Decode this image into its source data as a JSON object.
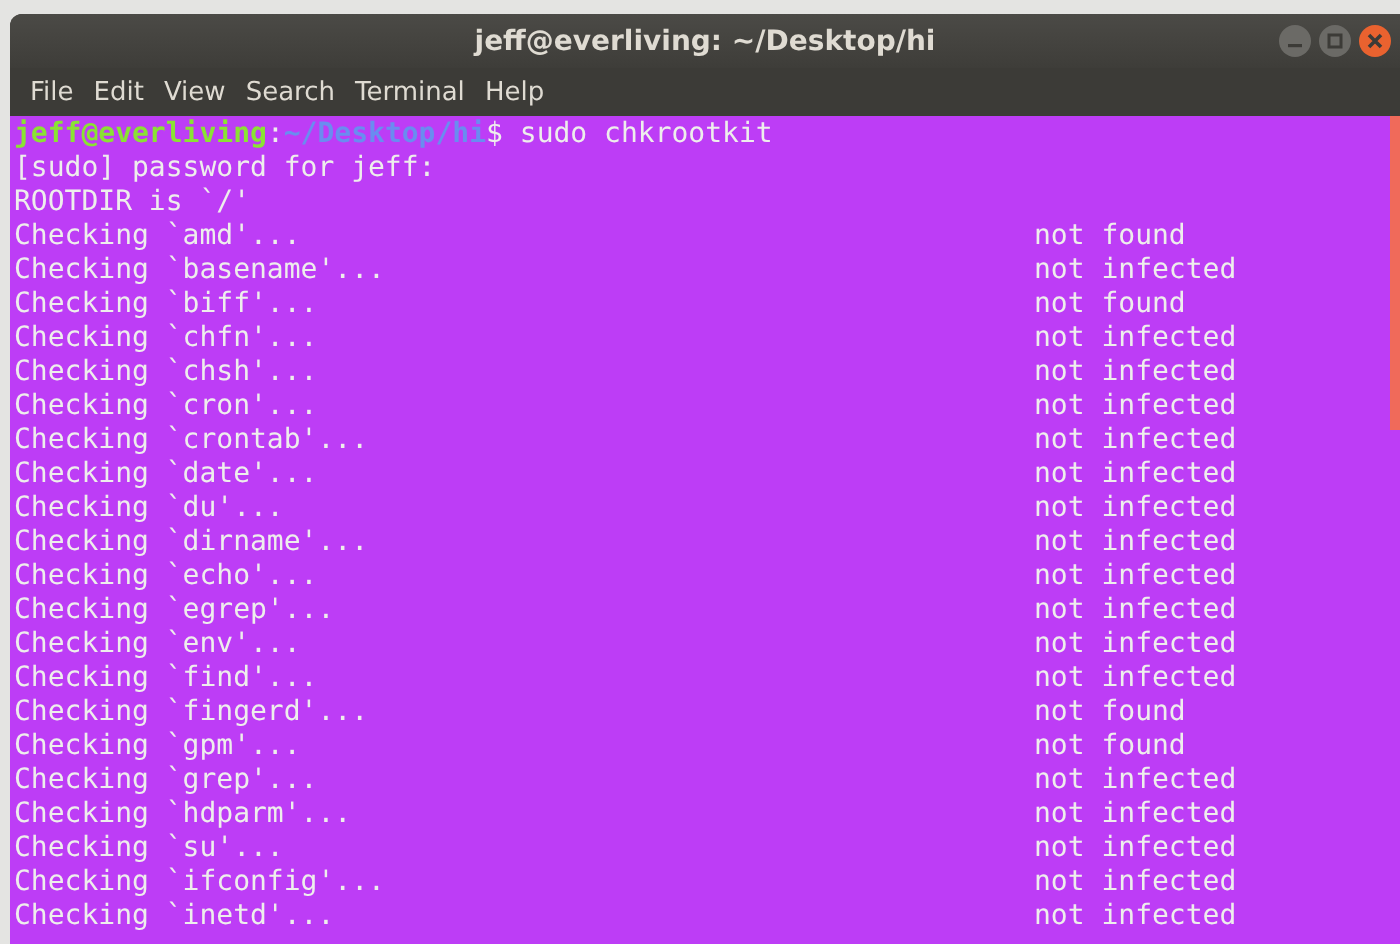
{
  "window": {
    "title": "jeff@everliving: ~/Desktop/hi"
  },
  "menu": [
    "File",
    "Edit",
    "View",
    "Search",
    "Terminal",
    "Help"
  ],
  "terminal": {
    "prompt": {
      "user": "jeff@everliving",
      "separator": ":",
      "path": "~/Desktop/hi",
      "command": "$ sudo chkrootkit"
    },
    "output": [
      "[sudo] password for jeff:",
      "ROOTDIR is `/'"
    ],
    "checks": [
      {
        "name": "Checking `amd'...",
        "result": "not found"
      },
      {
        "name": "Checking `basename'...",
        "result": "not infected"
      },
      {
        "name": "Checking `biff'...",
        "result": "not found"
      },
      {
        "name": "Checking `chfn'...",
        "result": "not infected"
      },
      {
        "name": "Checking `chsh'...",
        "result": "not infected"
      },
      {
        "name": "Checking `cron'...",
        "result": "not infected"
      },
      {
        "name": "Checking `crontab'...",
        "result": "not infected"
      },
      {
        "name": "Checking `date'...",
        "result": "not infected"
      },
      {
        "name": "Checking `du'...",
        "result": "not infected"
      },
      {
        "name": "Checking `dirname'...",
        "result": "not infected"
      },
      {
        "name": "Checking `echo'...",
        "result": "not infected"
      },
      {
        "name": "Checking `egrep'...",
        "result": "not infected"
      },
      {
        "name": "Checking `env'...",
        "result": "not infected"
      },
      {
        "name": "Checking `find'...",
        "result": "not infected"
      },
      {
        "name": "Checking `fingerd'...",
        "result": "not found"
      },
      {
        "name": "Checking `gpm'...",
        "result": "not found"
      },
      {
        "name": "Checking `grep'...",
        "result": "not infected"
      },
      {
        "name": "Checking `hdparm'...",
        "result": "not infected"
      },
      {
        "name": "Checking `su'...",
        "result": "not infected"
      },
      {
        "name": "Checking `ifconfig'...",
        "result": "not infected"
      },
      {
        "name": "Checking `inetd'...",
        "result": "not infected"
      }
    ]
  }
}
